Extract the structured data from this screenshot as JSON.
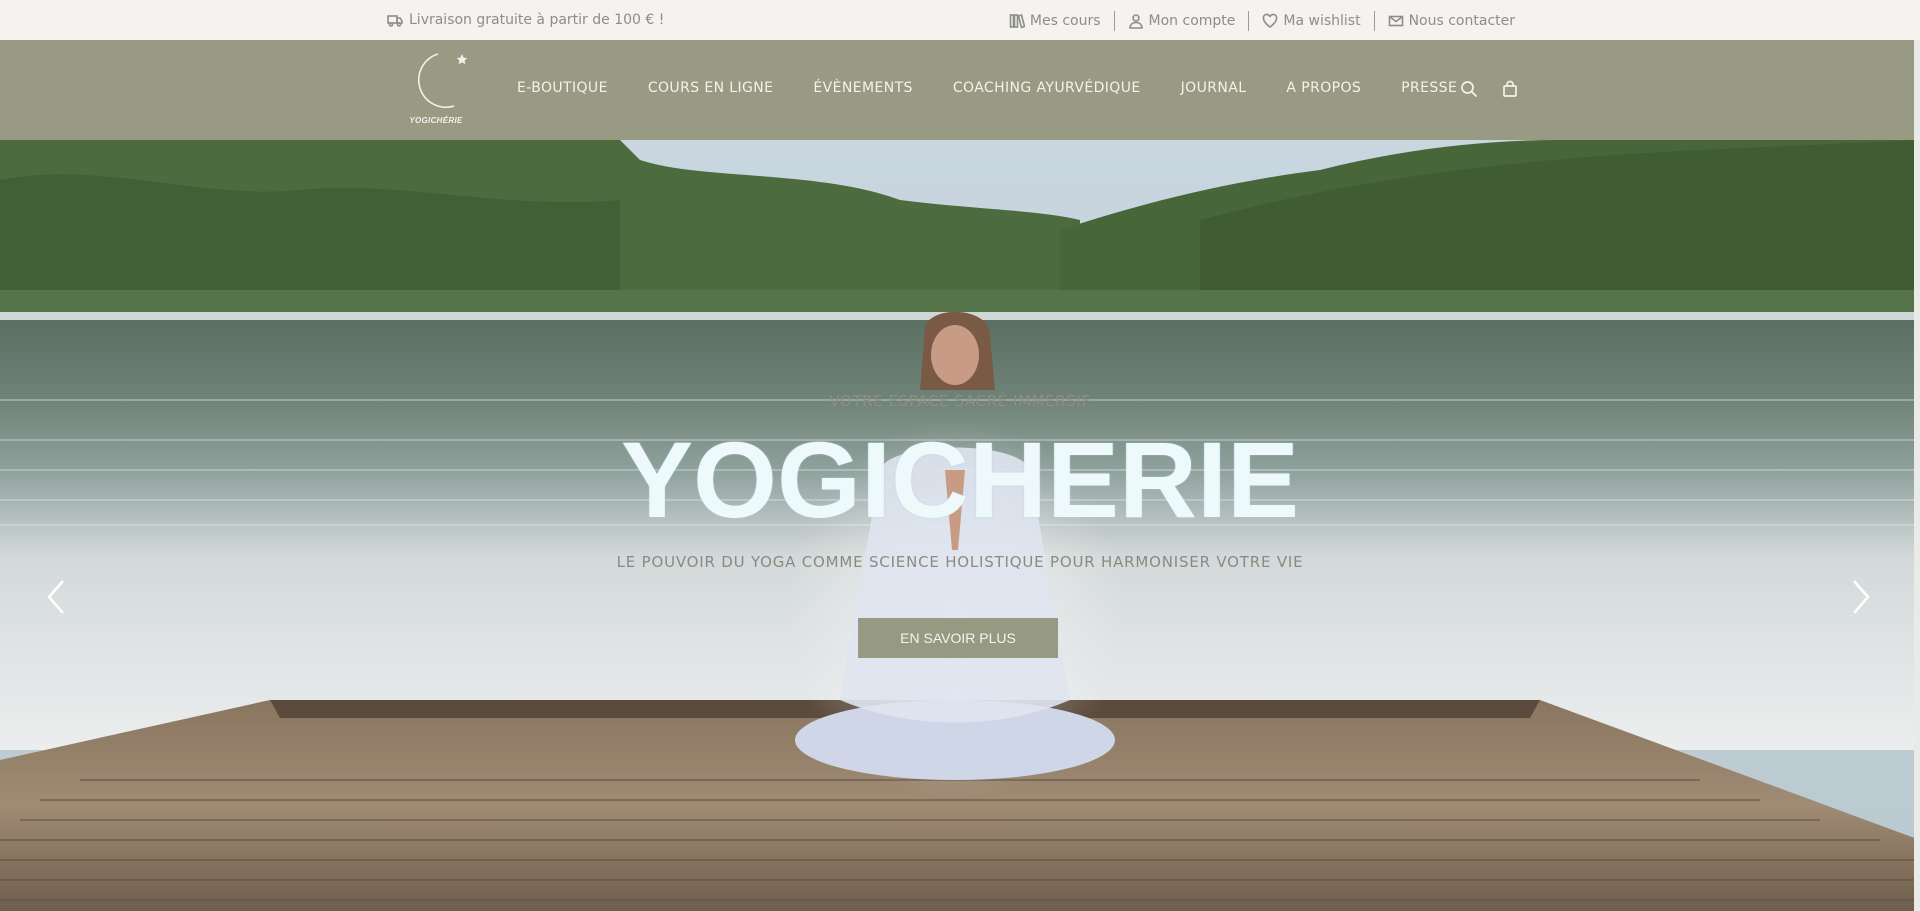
{
  "topbar": {
    "promo": "Livraison gratuite à partir de 100 € !",
    "promo_icon": "truck-icon",
    "links": [
      {
        "label": "Mes cours",
        "icon": "books-icon"
      },
      {
        "label": "Mon compte",
        "icon": "user-icon"
      },
      {
        "label": "Ma wishlist",
        "icon": "heart-icon"
      },
      {
        "label": "Nous contacter",
        "icon": "mail-icon"
      }
    ]
  },
  "nav": {
    "logo_text": "YOGICHÉRIE",
    "items": [
      "E-BOUTIQUE",
      "COURS EN LIGNE",
      "ÉVÈNEMENTS",
      "COACHING AYURVÉDIQUE",
      "JOURNAL",
      "A PROPOS",
      "PRESSE"
    ]
  },
  "hero": {
    "subtitle": "VOTRE ESPACE SACRÉ IMMERSIF",
    "title": "YOGICHERIE",
    "tagline": "LE POUVOIR DU YOGA COMME SCIENCE HOLISTIQUE POUR HARMONISER VOTRE VIE",
    "cta": "EN SAVOIR PLUS"
  },
  "colors": {
    "nav_bg": "#989a84",
    "topbar_bg": "#f6f2ef",
    "accent": "#979a83"
  }
}
